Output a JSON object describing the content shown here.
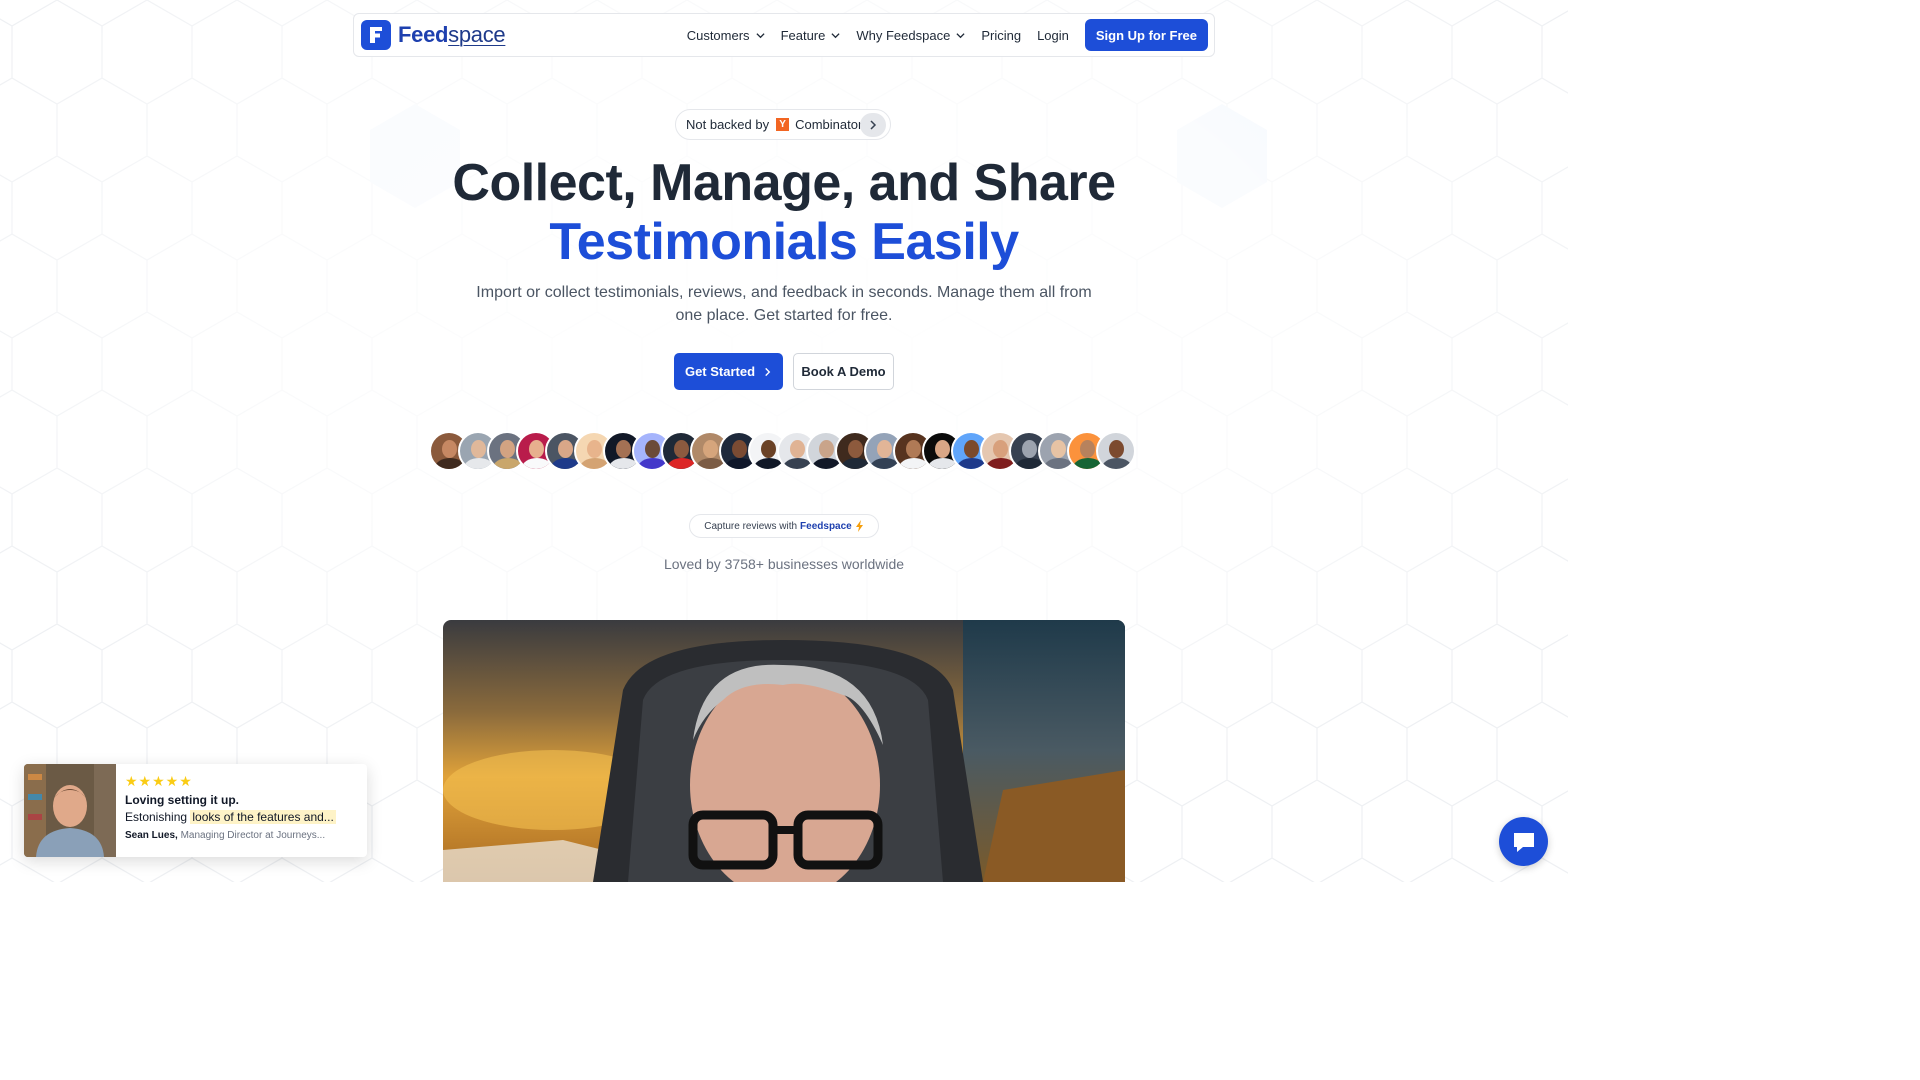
{
  "brand": {
    "name_part1": "Feed",
    "name_part2": "space"
  },
  "nav": {
    "customers": "Customers",
    "feature": "Feature",
    "why": "Why Feedspace",
    "pricing": "Pricing",
    "login": "Login",
    "signup": "Sign Up for Free"
  },
  "badge": {
    "prefix": "Not backed by",
    "yc_letter": "Y",
    "suffix": "Combinator"
  },
  "hero": {
    "line1": "Collect, Manage, and Share",
    "line2": "Testimonials Easily",
    "subtitle": "Import or collect testimonials, reviews, and feedback in seconds. Manage them all from one place. Get started for free."
  },
  "buttons": {
    "get_started": "Get Started",
    "book_demo": "Book A Demo"
  },
  "capture": {
    "prefix": "Capture reviews with",
    "brand": "Feedspace"
  },
  "loved": "Loved by 3758+ businesses worldwide",
  "toast": {
    "stars": "★★★★★",
    "title": "Loving setting it up.",
    "text_plain": "Estonishing",
    "text_highlight": "looks of the features and...",
    "author": "Sean Lues,",
    "role": "Managing Director at Journeys..."
  },
  "colors": {
    "primary": "#1d4ed8",
    "heading": "#1f2937",
    "muted": "#6b7280",
    "star": "#facc15"
  },
  "icons": [
    "chevron-down-icon",
    "chevron-right-icon",
    "lightning-icon",
    "chat-icon",
    "logo-icon"
  ]
}
